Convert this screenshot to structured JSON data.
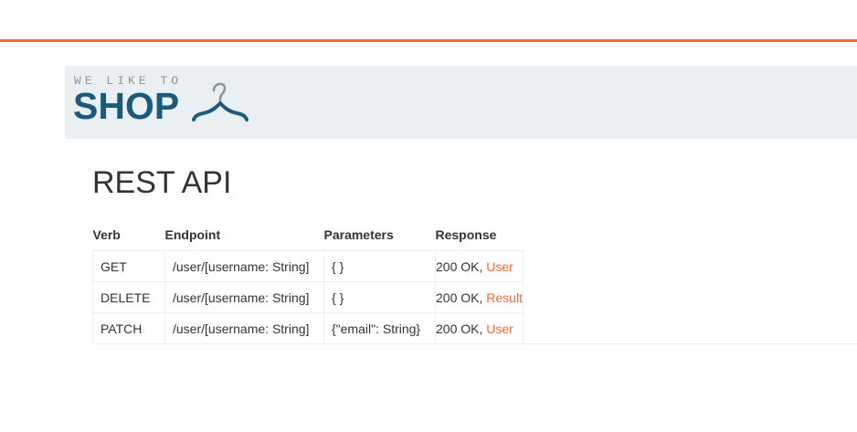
{
  "colors": {
    "accent": "#f26b3a",
    "brand": "#1a5b7c",
    "banner_bg": "#eaeff2"
  },
  "logo": {
    "tagline": "WE LIKE TO",
    "word": "SHOP",
    "icon": "hanger-icon"
  },
  "page": {
    "title": "REST API"
  },
  "table": {
    "headers": {
      "verb": "Verb",
      "endpoint": "Endpoint",
      "parameters": "Parameters",
      "response": "Response"
    },
    "rows": [
      {
        "verb": "GET",
        "endpoint": "/user/[username: String]",
        "parameters": "{ }",
        "status": "200 OK, ",
        "type": "User"
      },
      {
        "verb": "DELETE",
        "endpoint": "/user/[username: String]",
        "parameters": "{ }",
        "status": "200 OK, ",
        "type": "Result"
      },
      {
        "verb": "PATCH",
        "endpoint": "/user/[username: String]",
        "parameters": "{\"email\": String}",
        "status": "200 OK, ",
        "type": "User"
      }
    ]
  }
}
